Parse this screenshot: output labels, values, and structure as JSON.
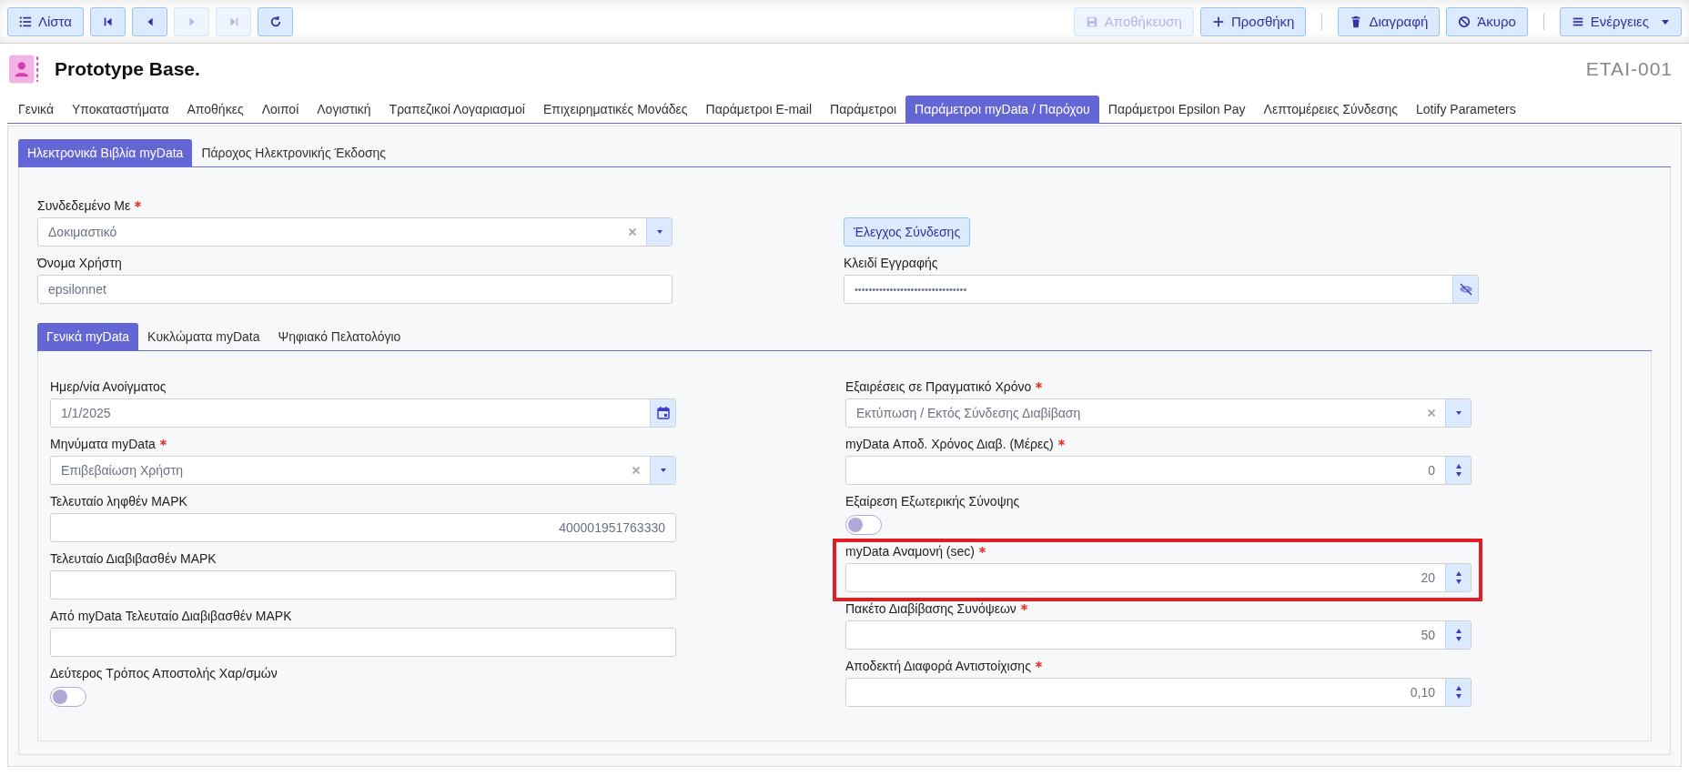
{
  "toolbar": {
    "left": [
      {
        "kind": "list",
        "label": "Λίστα",
        "disabled": false
      },
      {
        "kind": "first",
        "disabled": false
      },
      {
        "kind": "prev",
        "disabled": false
      },
      {
        "kind": "next",
        "disabled": true
      },
      {
        "kind": "last",
        "disabled": true
      },
      {
        "kind": "refresh",
        "disabled": false
      }
    ],
    "right_groups": [
      [
        {
          "kind": "save",
          "label": "Αποθήκευση",
          "disabled": true
        },
        {
          "kind": "add",
          "label": "Προσθήκη",
          "disabled": false
        }
      ],
      [
        {
          "kind": "delete",
          "label": "Διαγραφή",
          "disabled": false
        },
        {
          "kind": "cancel",
          "label": "Άκυρο",
          "disabled": false
        }
      ],
      [
        {
          "kind": "actions",
          "label": "Ενέργειες",
          "disabled": false,
          "dropdown": true
        }
      ]
    ]
  },
  "header": {
    "title": "Prototype Base.",
    "code": "ETAI-001"
  },
  "tabs": [
    {
      "label": "Γενικά",
      "selected": false
    },
    {
      "label": "Υποκαταστήματα",
      "selected": false
    },
    {
      "label": "Αποθήκες",
      "selected": false
    },
    {
      "label": "Λοιποί",
      "selected": false
    },
    {
      "label": "Λογιστική",
      "selected": false
    },
    {
      "label": "Τραπεζικοί Λογαριασμοί",
      "selected": false
    },
    {
      "label": "Επιχειρηματικές Μονάδες",
      "selected": false
    },
    {
      "label": "Παράμετροι E-mail",
      "selected": false
    },
    {
      "label": "Παράμετροι",
      "selected": false
    },
    {
      "label": "Παράμετροι myData / Παρόχου",
      "selected": true
    },
    {
      "label": "Παράμετροι Epsilon Pay",
      "selected": false
    },
    {
      "label": "Λεπτομέρειες Σύνδεσης",
      "selected": false
    },
    {
      "label": "Lotify Parameters",
      "selected": false
    }
  ],
  "subtabs": [
    {
      "label": "Ηλεκτρονικά Βιβλία myData",
      "selected": true
    },
    {
      "label": "Πάροχος Ηλεκτρονικής Έκδοσης",
      "selected": false
    }
  ],
  "top_form": {
    "columns": [
      [
        {
          "kind": "select",
          "label": "Συνδεδεμένο Με",
          "required": true,
          "value": "Δοκιμαστικό"
        },
        {
          "kind": "text",
          "label": "Όνομα Χρήστη",
          "required": false,
          "value": "epsilonnet"
        }
      ],
      [
        {
          "kind": "button",
          "label": "Έλεγχος Σύνδεσης"
        },
        {
          "kind": "password",
          "label": "Κλειδί Εγγραφής",
          "required": false,
          "value": "••••••••••••••••••••••••••••••••"
        }
      ]
    ]
  },
  "nested_tabs": [
    {
      "label": "Γενικά myData",
      "selected": true
    },
    {
      "label": "Κυκλώματα myData",
      "selected": false
    },
    {
      "label": "Ψηφιακό Πελατολόγιο",
      "selected": false
    }
  ],
  "lower_form": {
    "columns": [
      [
        {
          "kind": "date",
          "label": "Ημερ/νία Ανοίγματος",
          "required": false,
          "value": "1/1/2025"
        },
        {
          "kind": "select",
          "label": "Μηνύματα myData",
          "required": true,
          "value": "Επιβεβαίωση Χρήστη"
        },
        {
          "kind": "number_readonly",
          "label": "Τελευταίο ληφθέν ΜΑΡΚ",
          "required": false,
          "value": "400001951763330"
        },
        {
          "kind": "text",
          "label": "Τελευταίο Διαβιβασθέν ΜΑΡΚ",
          "required": false
        },
        {
          "kind": "text",
          "label": "Από myData Τελευταίο Διαβιβασθέν ΜΑΡΚ",
          "required": false
        },
        {
          "kind": "toggle",
          "label": "Δεύτερος Τρόπος Αποστολής Χαρ/σμών",
          "required": false,
          "on": false
        }
      ],
      [
        {
          "kind": "select",
          "label": "Εξαιρέσεις σε Πραγματικό Χρόνο",
          "required": true,
          "value": "Εκτύπωση / Εκτός Σύνδεσης Διαβίβαση"
        },
        {
          "kind": "number",
          "label": "myData Αποδ. Χρόνος Διαβ. (Μέρες)",
          "required": true,
          "value": "0",
          "highlighted": false
        },
        {
          "kind": "toggle",
          "label": "Εξαίρεση Εξωτερικής Σύνοψης",
          "required": false,
          "on": false
        },
        {
          "kind": "number",
          "label": "myData Αναμονή (sec)",
          "required": true,
          "value": "20",
          "highlighted": true
        },
        {
          "kind": "number",
          "label": "Πακέτο Διαβίβασης Συνόψεων",
          "required": true,
          "value": "50",
          "highlighted": false
        },
        {
          "kind": "number",
          "label": "Αποδεκτή Διαφορά Αντιστοίχισης",
          "required": true,
          "value": "0,10",
          "highlighted": false
        }
      ]
    ]
  }
}
